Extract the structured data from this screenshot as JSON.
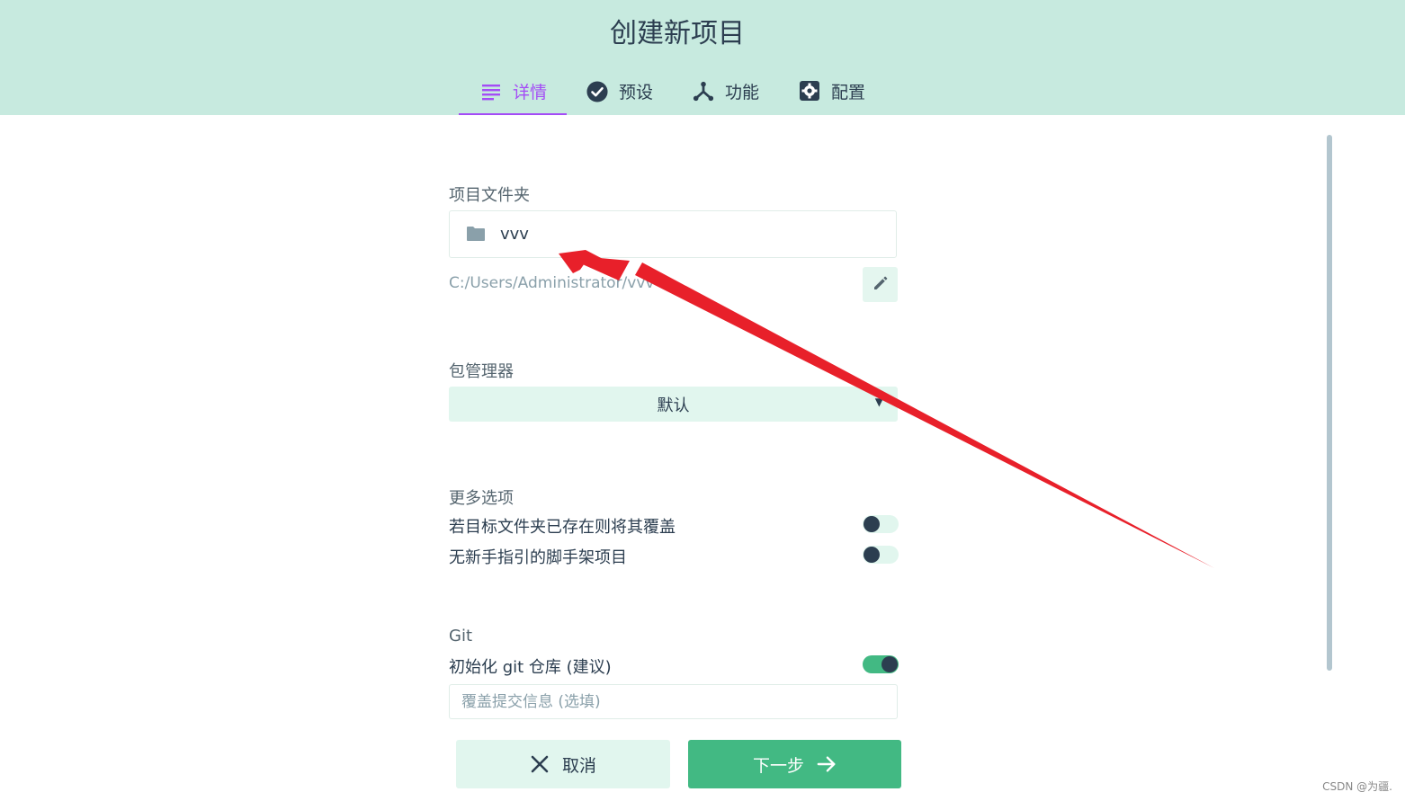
{
  "header": {
    "title": "创建新项目",
    "tabs": [
      {
        "label": "详情",
        "icon": "list-icon",
        "active": true
      },
      {
        "label": "预设",
        "icon": "check-circle-icon",
        "active": false
      },
      {
        "label": "功能",
        "icon": "fork-icon",
        "active": false
      },
      {
        "label": "配置",
        "icon": "gear-icon",
        "active": false
      }
    ]
  },
  "folder": {
    "label": "项目文件夹",
    "value": "vvv",
    "path": "C:/Users/Administrator/vvv"
  },
  "package_manager": {
    "label": "包管理器",
    "selected": "默认"
  },
  "options": {
    "label": "更多选项",
    "items": [
      {
        "text": "若目标文件夹已存在则将其覆盖",
        "on": false
      },
      {
        "text": "无新手指引的脚手架项目",
        "on": false
      }
    ]
  },
  "git": {
    "label": "Git",
    "init_text": "初始化 git 仓库 (建议)",
    "init_on": true,
    "commit_placeholder": "覆盖提交信息 (选填)"
  },
  "actions": {
    "cancel": "取消",
    "next": "下一步"
  },
  "watermark": "CSDN @为疆.",
  "colors": {
    "header_bg": "#c7eadf",
    "accent_purple": "#a44cf6",
    "primary_green": "#42b983",
    "light_green": "#e1f6ee",
    "annotation_red": "#e8202a"
  }
}
